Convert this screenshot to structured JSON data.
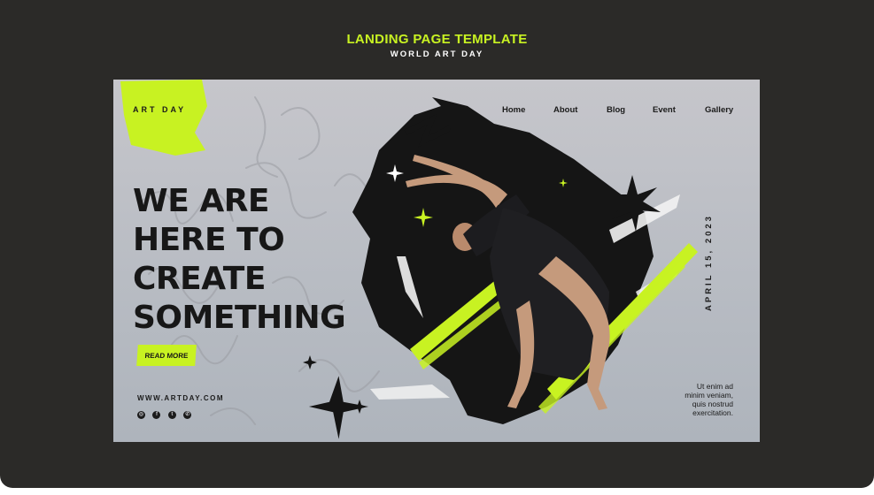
{
  "header": {
    "title": "LANDING PAGE TEMPLATE",
    "subtitle": "WORLD ART DAY"
  },
  "site": {
    "logo": "ART DAY",
    "nav": [
      {
        "label": "Home",
        "active": true
      },
      {
        "label": "About",
        "active": false
      },
      {
        "label": "Blog",
        "active": false
      },
      {
        "label": "Event",
        "active": false
      },
      {
        "label": "Gallery",
        "active": false
      }
    ],
    "headline": [
      "WE ARE",
      "HERE TO",
      "CREATE",
      "SOMETHING"
    ],
    "cta_label": "READ MORE",
    "website": "WWW.ARTDAY.COM",
    "socials": [
      "instagram-icon",
      "facebook-icon",
      "twitter-icon",
      "whatsapp-icon"
    ],
    "date": "APRIL 15, 2023",
    "description": [
      "Ut enim ad",
      "minim veniam,",
      "quis nostrud",
      "exercitation."
    ]
  },
  "colors": {
    "accent": "#c8f222",
    "dark": "#171717",
    "frame": "#2b2a28",
    "card": "#c0c2c7"
  }
}
